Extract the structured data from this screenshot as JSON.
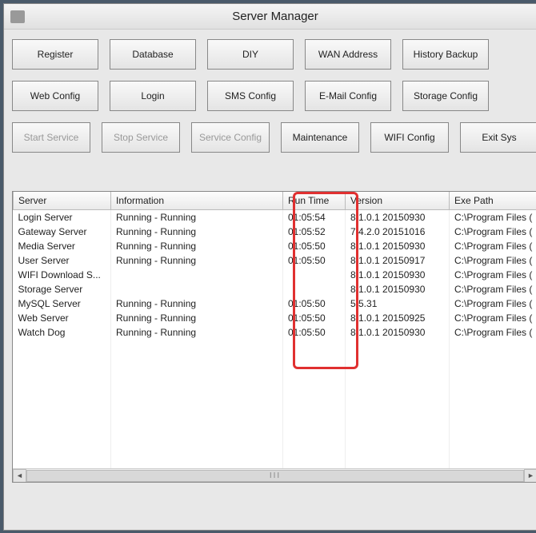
{
  "window": {
    "title": "Server Manager"
  },
  "toolbar": {
    "row1": [
      {
        "label": "Register",
        "enabled": true
      },
      {
        "label": "Database",
        "enabled": true
      },
      {
        "label": "DIY",
        "enabled": true
      },
      {
        "label": "WAN Address",
        "enabled": true
      },
      {
        "label": "History Backup",
        "enabled": true
      }
    ],
    "row2": [
      {
        "label": "Web Config",
        "enabled": true
      },
      {
        "label": "Login",
        "enabled": true
      },
      {
        "label": "SMS Config",
        "enabled": true
      },
      {
        "label": "E-Mail Config",
        "enabled": true
      },
      {
        "label": "Storage Config",
        "enabled": true
      }
    ],
    "row3": [
      {
        "label": "Start Service",
        "enabled": false
      },
      {
        "label": "Stop Service",
        "enabled": false
      },
      {
        "label": "Service Config",
        "enabled": false
      },
      {
        "label": "Maintenance",
        "enabled": true
      },
      {
        "label": "WIFI Config",
        "enabled": true
      },
      {
        "label": "Exit Sys",
        "enabled": true
      }
    ]
  },
  "table": {
    "columns": [
      "Server",
      "Information",
      "Run Time",
      "Version",
      "Exe Path"
    ],
    "rows": [
      {
        "server": "Login Server",
        "info": "Running - Running",
        "runtime": "01:05:54",
        "version": "8.1.0.1 20150930",
        "exe": "C:\\Program Files ("
      },
      {
        "server": "Gateway Server",
        "info": "Running - Running",
        "runtime": "01:05:52",
        "version": "7.4.2.0 20151016",
        "exe": "C:\\Program Files ("
      },
      {
        "server": "Media Server",
        "info": "Running - Running",
        "runtime": "01:05:50",
        "version": "8.1.0.1 20150930",
        "exe": "C:\\Program Files ("
      },
      {
        "server": "User Server",
        "info": "Running - Running",
        "runtime": "01:05:50",
        "version": "8.1.0.1 20150917",
        "exe": "C:\\Program Files ("
      },
      {
        "server": "WIFI Download S...",
        "info": "",
        "runtime": "",
        "version": "8.1.0.1 20150930",
        "exe": "C:\\Program Files ("
      },
      {
        "server": "Storage Server",
        "info": "",
        "runtime": "",
        "version": "8.1.0.1 20150930",
        "exe": "C:\\Program Files ("
      },
      {
        "server": "MySQL Server",
        "info": "Running - Running",
        "runtime": "01:05:50",
        "version": "5.5.31",
        "exe": "C:\\Program Files ("
      },
      {
        "server": "Web Server",
        "info": "Running - Running",
        "runtime": "01:05:50",
        "version": "8.1.0.1 20150925",
        "exe": "C:\\Program Files ("
      },
      {
        "server": "Watch Dog",
        "info": "Running - Running",
        "runtime": "01:05:50",
        "version": "8.1.0.1 20150930",
        "exe": "C:\\Program Files ("
      }
    ],
    "blank_rows": 9
  }
}
